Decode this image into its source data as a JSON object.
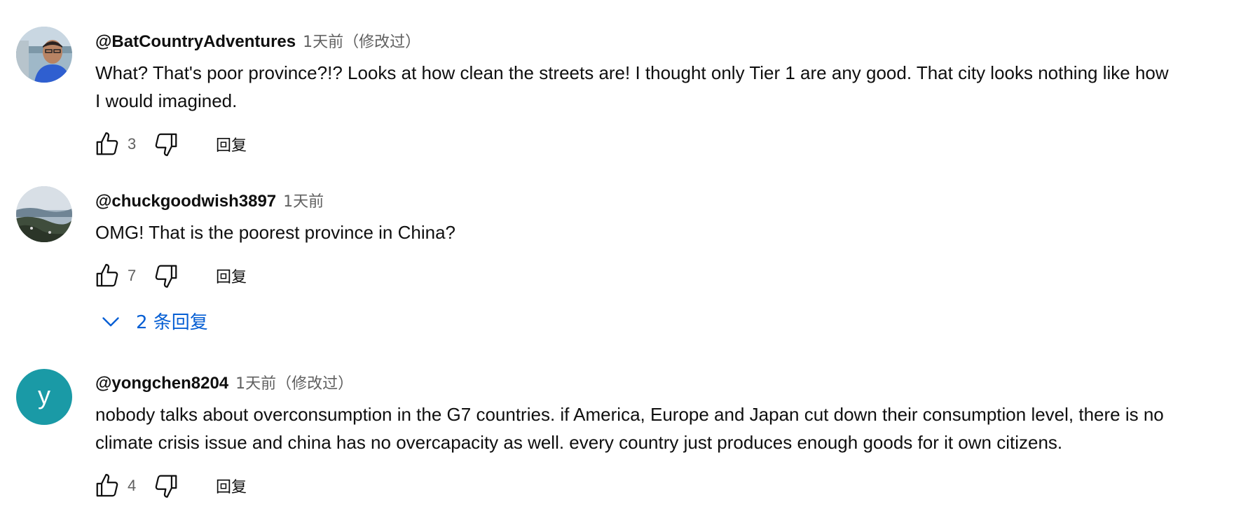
{
  "comments": [
    {
      "avatar": "photo-avatar-man",
      "author": "@BatCountryAdventures",
      "time": "1天前（修改过）",
      "text_lines": [
        "What? That's poor province?!? Looks at how clean the streets are! I thought only Tier 1 are any good. That city looks nothing like how",
        "I would imagined."
      ],
      "likes": "3",
      "reply_label": "回复"
    },
    {
      "avatar": "photo-avatar-landscape",
      "author": "@chuckgoodwish3897",
      "time": "1天前",
      "text_lines": [
        "OMG! That is the poorest province in China?"
      ],
      "likes": "7",
      "reply_label": "回复",
      "replies_toggle": "2 条回复"
    },
    {
      "avatar_letter": "y",
      "avatar_color": "#1a9aa6",
      "author": "@yongchen8204",
      "time": "1天前（修改过）",
      "text_lines": [
        "nobody talks about overconsumption in the G7 countries. if America, Europe and Japan cut down their consumption level, there is no",
        "climate crisis issue and china has no overcapacity as well. every country just produces enough goods for it own citizens."
      ],
      "likes": "4",
      "reply_label": "回复"
    }
  ],
  "icons": {
    "like": "thumb-up-icon",
    "dislike": "thumb-down-icon",
    "expand": "chevron-down-icon"
  },
  "colors": {
    "link_blue": "#065fd4",
    "secondary_text": "#606060"
  }
}
